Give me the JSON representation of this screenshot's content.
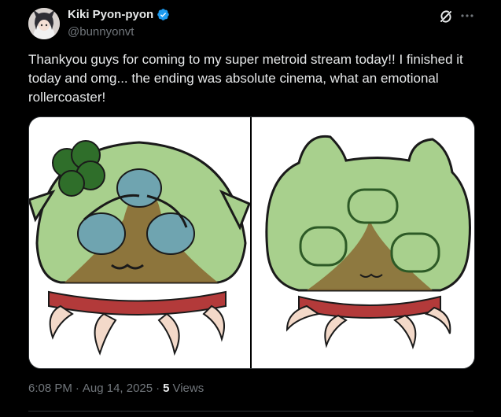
{
  "author": {
    "display_name": "Kiki Pyon-pyon",
    "handle": "@bunnyonvt",
    "verified": true
  },
  "tweet": {
    "text": "Thankyou guys for coming to my super metroid stream today!! I finished it today and omg... the ending was absolute cinema, what an emotional rollercoaster!",
    "time": "6:08 PM",
    "date": "Aug 14, 2025",
    "separator": "·",
    "views_count": "5",
    "views_label": "Views"
  },
  "icons": {
    "verified": "verified-badge-icon",
    "grok": "grok-icon",
    "more": "more-icon"
  },
  "colors": {
    "background": "#000000",
    "text": "#e7e9ea",
    "muted": "#71767b",
    "verified": "#1d9bf0",
    "metroid_green": "#a8d08d",
    "metroid_brown": "#8a6a33",
    "claws_red": "#c0392b"
  }
}
